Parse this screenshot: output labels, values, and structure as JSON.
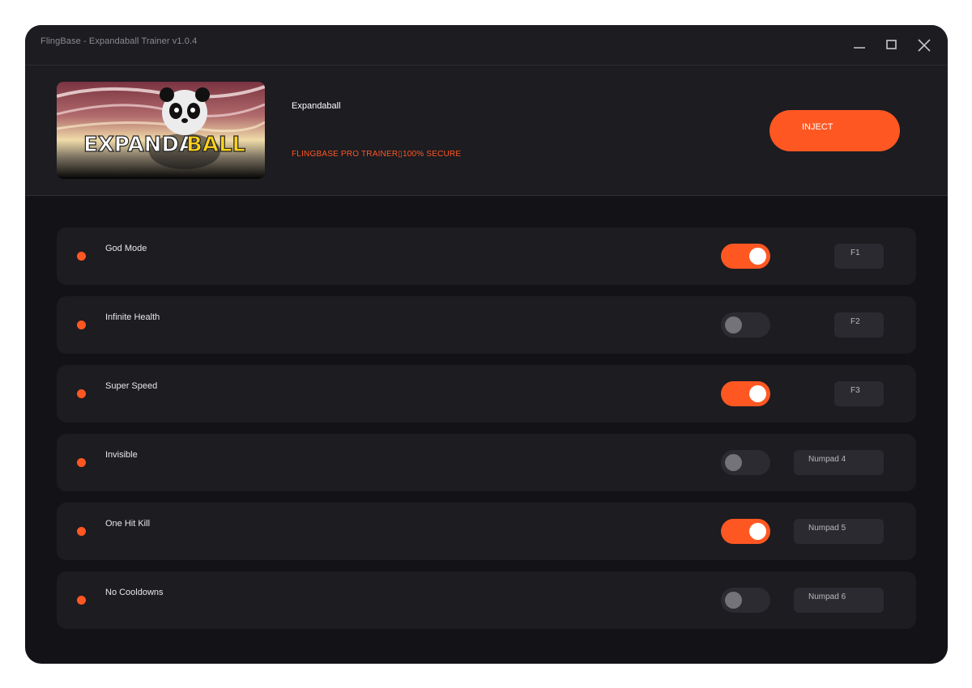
{
  "window": {
    "title": "FlingBase - Expandaball Trainer v1.0.4",
    "controls": [
      "minimize-icon",
      "maximize-icon",
      "close-icon"
    ]
  },
  "header": {
    "banner_text": "EXPANDABALL",
    "game_name": "Expandaball",
    "tagline": "FLINGBASE PRO TRAINER▯100% SECURE",
    "inject_label": "INJECT"
  },
  "colors": {
    "accent": "#ff5722",
    "background": "#131317",
    "panel": "#1c1c21",
    "keycap": "#2a2a30"
  },
  "cheats": [
    {
      "label": "God Mode",
      "enabled": true,
      "hotkey": "F1"
    },
    {
      "label": "Infinite Health",
      "enabled": false,
      "hotkey": "F2"
    },
    {
      "label": "Super Speed",
      "enabled": true,
      "hotkey": "F3"
    },
    {
      "label": "Invisible",
      "enabled": false,
      "hotkey": "Numpad 4"
    },
    {
      "label": "One Hit Kill",
      "enabled": true,
      "hotkey": "Numpad 5"
    },
    {
      "label": "No Cooldowns",
      "enabled": false,
      "hotkey": "Numpad 6"
    }
  ]
}
